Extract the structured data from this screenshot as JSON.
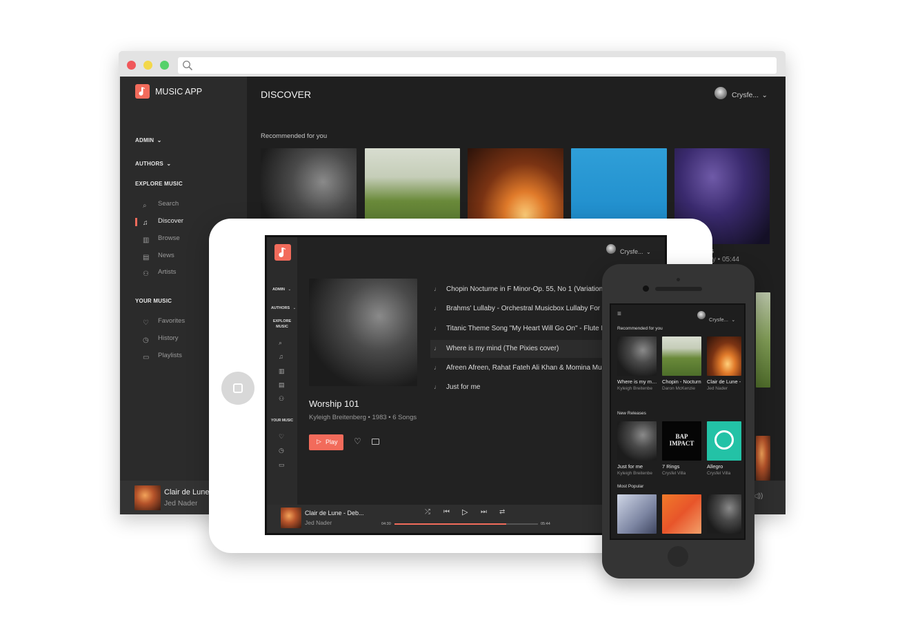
{
  "app": {
    "name": "MUSIC APP",
    "page_title": "DISCOVER",
    "user_name": "Crysfe...",
    "accent_color": "#f26b5b"
  },
  "sidebar": {
    "admin": "ADMIN",
    "authors": "AUTHORS",
    "explore_heading": "EXPLORE MUSIC",
    "explore_items": [
      {
        "label": "Search",
        "icon": "search-icon"
      },
      {
        "label": "Discover",
        "icon": "music-note-icon",
        "active": true
      },
      {
        "label": "Browse",
        "icon": "bar-chart-icon"
      },
      {
        "label": "News",
        "icon": "newspaper-icon"
      },
      {
        "label": "Artists",
        "icon": "people-icon"
      }
    ],
    "your_music_heading": "YOUR MUSIC",
    "your_music_items": [
      {
        "label": "Favorites",
        "icon": "heart-icon"
      },
      {
        "label": "History",
        "icon": "clock-icon"
      },
      {
        "label": "Playlists",
        "icon": "folder-icon"
      }
    ]
  },
  "desktop": {
    "section_recommended": "Recommended for you",
    "partial_meta": "ery • 05:44",
    "partial_title": "s",
    "player": {
      "title": "Clair de Lune -",
      "artist": "Jed Nader"
    }
  },
  "tablet": {
    "explore_heading_line1": "EXPLORE",
    "explore_heading_line2": "MUSIC",
    "your_music_heading": "YOUR MUSIC",
    "album": {
      "title": "Worship 101",
      "meta": "Kyleigh Breitenberg • 1983 • 6 Songs",
      "play_label": "Play"
    },
    "tracks": [
      "Chopin Nocturne in F Minor-Op. 55, No 1 (Variation) Pia...",
      "Brahms' Lullaby - Orchestral Musicbox Lullaby For Babie",
      "Titanic Theme Song \"My Heart Will Go On\" - Flute Instru...",
      "Where is my mind (The Pixies cover)",
      "Afreen Afreen, Rahat Fateh Ali Khan & Momina Mustehsa",
      "Just for me"
    ],
    "highlighted_track_index": 3,
    "player": {
      "title": "Clair de Lune - Deb...",
      "artist": "Jed Nader",
      "elapsed": "04:30",
      "duration": "05:44",
      "progress": 0.78
    }
  },
  "phone": {
    "user_name": "Crysfe...",
    "section_recommended": "Recommended for you",
    "recommended": [
      {
        "title": "Where is my mind",
        "artist": "Kyleigh Breitenbe"
      },
      {
        "title": "Chopin - Nocturn",
        "artist": "Daron McKenzie"
      },
      {
        "title": "Clair de Lune -",
        "artist": "Jed Nader"
      }
    ],
    "section_new": "New Releases",
    "new_releases": [
      {
        "title": "Just for me",
        "artist": "Kyleigh Breitenbe"
      },
      {
        "title": "7 Rings",
        "artist": "Crysfel Villa"
      },
      {
        "title": "Allegro",
        "artist": "Crysfel Villa"
      }
    ],
    "badge_text_line1": "BAP",
    "badge_text_line2": "IMPACT",
    "section_popular": "Most Popular"
  }
}
